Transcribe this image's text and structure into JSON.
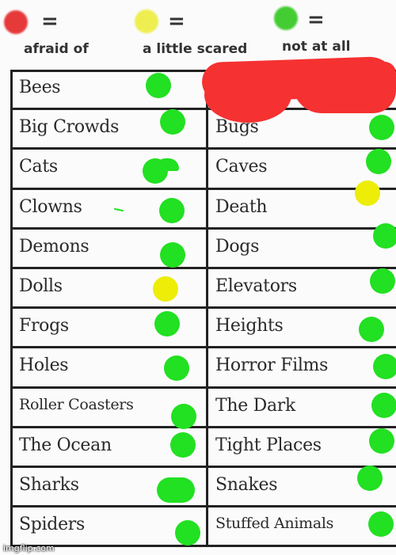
{
  "legend": [
    {
      "color_name": "red",
      "color": "#e63a3a",
      "symbol": "=",
      "label": "afraid of"
    },
    {
      "color_name": "yellow",
      "color": "#eeee50",
      "symbol": "=",
      "label": "a little scared"
    },
    {
      "color_name": "green",
      "color": "#44cc33",
      "symbol": "=",
      "label": "not at all"
    }
  ],
  "left_column": [
    {
      "label": "Bees",
      "rating": "not at all"
    },
    {
      "label": "Big Crowds",
      "rating": "not at all"
    },
    {
      "label": "Cats",
      "rating": "not at all"
    },
    {
      "label": "Clowns",
      "rating": "not at all"
    },
    {
      "label": "Demons",
      "rating": "not at all"
    },
    {
      "label": "Dolls",
      "rating": "a little scared"
    },
    {
      "label": "Frogs",
      "rating": "not at all"
    },
    {
      "label": "Holes",
      "rating": "not at all"
    },
    {
      "label": "Roller Coasters",
      "rating": "not at all"
    },
    {
      "label": "The Ocean",
      "rating": "not at all"
    },
    {
      "label": "Sharks",
      "rating": "not at all"
    },
    {
      "label": "Spiders",
      "rating": "not at all"
    }
  ],
  "right_column": [
    {
      "label": "",
      "rating": "redacted"
    },
    {
      "label": "Bugs",
      "rating": "not at all"
    },
    {
      "label": "Caves",
      "rating": "not at all"
    },
    {
      "label": "Death",
      "rating": "a little scared"
    },
    {
      "label": "Dogs",
      "rating": "not at all"
    },
    {
      "label": "Elevators",
      "rating": "not at all"
    },
    {
      "label": "Heights",
      "rating": "not at all"
    },
    {
      "label": "Horror Films",
      "rating": "not at all"
    },
    {
      "label": "The Dark",
      "rating": "not at all"
    },
    {
      "label": "Tight Places",
      "rating": "not at all"
    },
    {
      "label": "Snakes",
      "rating": "not at all"
    },
    {
      "label": "Stuffed Animals",
      "rating": "not at all"
    }
  ],
  "colors": {
    "green_mark": "#22e022",
    "yellow_mark": "#eded08",
    "red_scribble": "#f53131"
  },
  "watermark": "imgflip.com"
}
